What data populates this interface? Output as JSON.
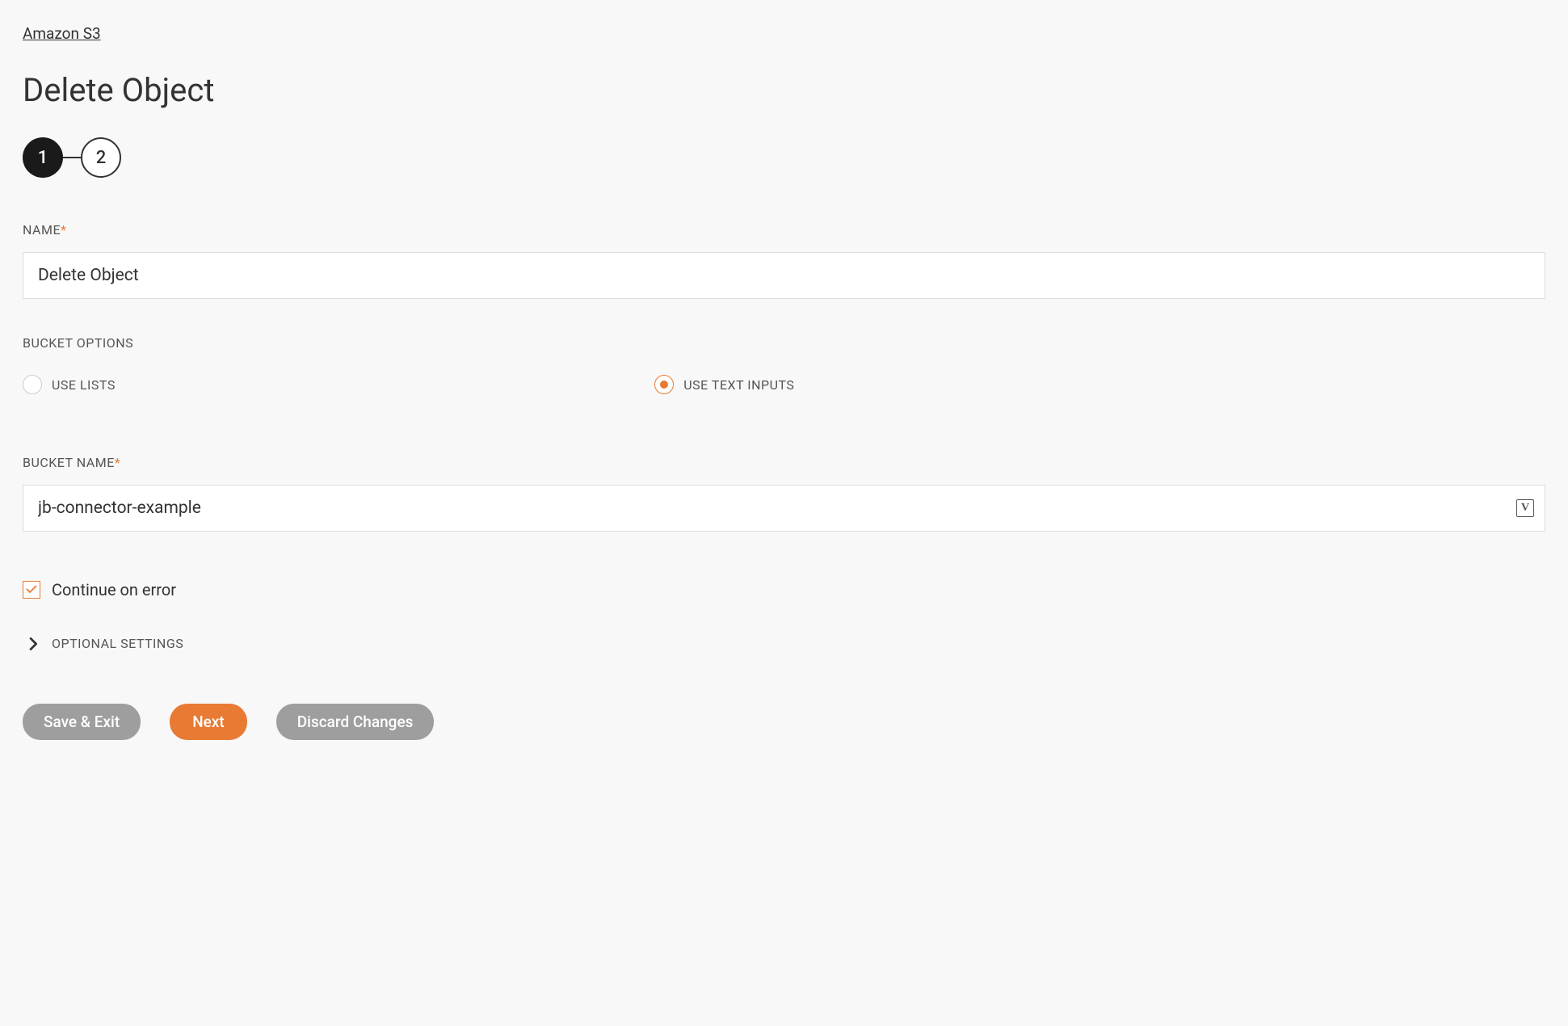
{
  "breadcrumb": "Amazon S3",
  "page_title": "Delete Object",
  "stepper": {
    "step1": "1",
    "step2": "2"
  },
  "fields": {
    "name": {
      "label": "NAME",
      "required": "*",
      "value": "Delete Object"
    },
    "bucket_options": {
      "label": "BUCKET OPTIONS",
      "option_lists": "USE LISTS",
      "option_text": "USE TEXT INPUTS"
    },
    "bucket_name": {
      "label": "BUCKET NAME",
      "required": "*",
      "value": "jb-connector-example",
      "icon_letter": "V"
    },
    "continue_on_error": {
      "label": "Continue on error"
    },
    "optional_settings": {
      "label": "OPTIONAL SETTINGS"
    }
  },
  "buttons": {
    "save_exit": "Save & Exit",
    "next": "Next",
    "discard": "Discard Changes"
  }
}
